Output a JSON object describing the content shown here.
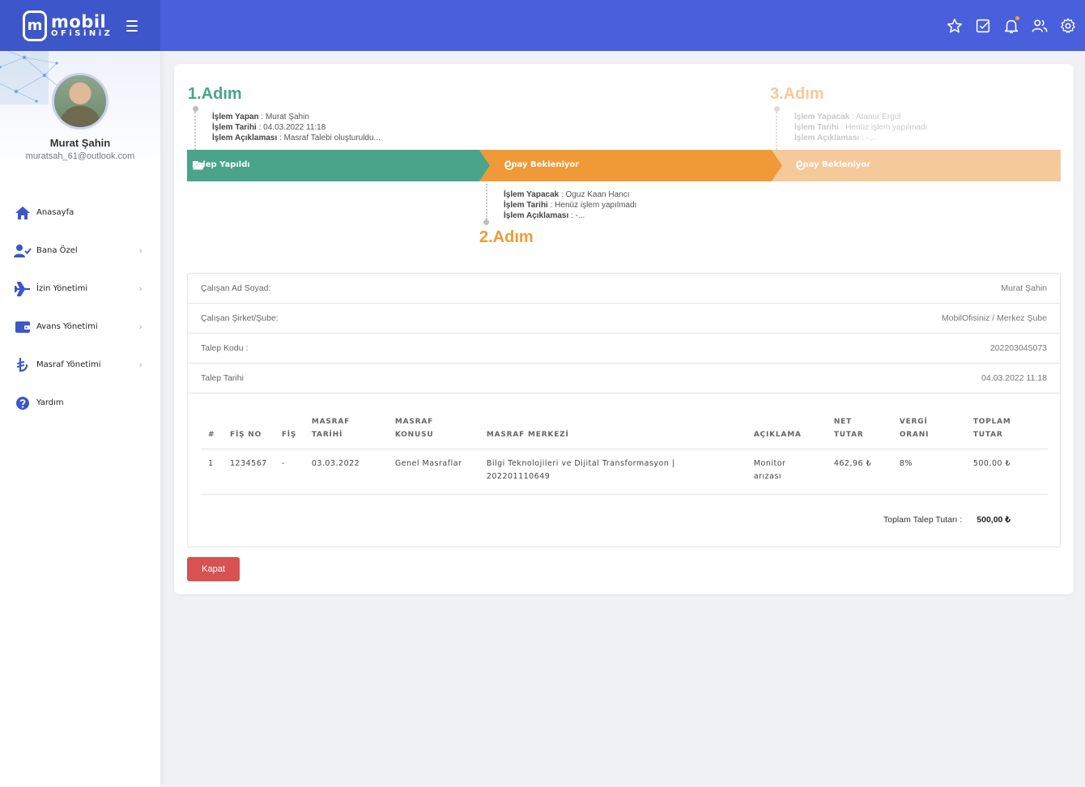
{
  "brand": {
    "line1": "mobil",
    "line2": "OFiSiNiZ",
    "mark": "m"
  },
  "user": {
    "name": "Murat Şahin",
    "email": "muratsah_61@outlook.com"
  },
  "nav": [
    {
      "label": "Anasayfa",
      "icon": "home-icon",
      "has_children": false
    },
    {
      "label": "Bana Özel",
      "icon": "user-check-icon",
      "has_children": true
    },
    {
      "label": "İzin Yönetimi",
      "icon": "plane-icon",
      "has_children": true
    },
    {
      "label": "Avans Yönetimi",
      "icon": "wallet-icon",
      "has_children": true
    },
    {
      "label": "Masraf Yönetimi",
      "icon": "lira-icon",
      "has_children": true
    },
    {
      "label": "Yardım",
      "icon": "help-icon",
      "has_children": false
    }
  ],
  "chevron": "›",
  "topbar_icons": [
    "star-icon",
    "checklist-icon",
    "bell-icon",
    "users-icon",
    "settings-icon"
  ],
  "steps": {
    "step1": {
      "title": "1.Adım",
      "l1_key": "İşlem Yapan",
      "l1_val": " : Murat Şahin",
      "l2_key": "İşlem Tarihi",
      "l2_val": " : 04.03.2022 11:18",
      "l3_key": "İşlem Açıklaması",
      "l3_val": " : Masraf Talebi oluşturuldu..."
    },
    "step2": {
      "title": "2.Adım",
      "l1_key": "İşlem Yapacak",
      "l1_val": " : Oguz Kaan Hancı",
      "l2_key": "İşlem Tarihi",
      "l2_val": " : Henüz işlem yapılmadı",
      "l3_key": "İşlem Açıklaması",
      "l3_val": " : -..."
    },
    "step3": {
      "title": "3.Adım",
      "l1_key": "İşlem Yapacak",
      "l1_val": " : Atanur Ergül",
      "l2_key": "İşlem Tarihi",
      "l2_val": " : Henüz işlem yapılmadı",
      "l3_key": "İşlem Açıklaması",
      "l3_val": " : -..."
    }
  },
  "progress": {
    "seg1": "Talep Yapıldı",
    "seg2": "Onay Bekleniyor",
    "seg3": "Onay Bekleniyor",
    "colors": {
      "done": "#4aa489",
      "active": "#ef9a36",
      "pending": "#f6c99a"
    }
  },
  "details": [
    {
      "label": "Çalışan Ad Soyad:",
      "value": "Murat Şahin"
    },
    {
      "label": "Çalışan Şirket/Şube:",
      "value": "MobilOfisiniz / Merkez Şube"
    },
    {
      "label": "Talep Kodu :",
      "value": "202203045073"
    },
    {
      "label": "Talep Tarihi",
      "value": "04.03.2022 11:18"
    }
  ],
  "table": {
    "headers": {
      "num": "#",
      "fis_no": "FİŞ NO",
      "fis": "FİŞ",
      "tarih_1": "MASRAF",
      "tarih_2": "TARİHİ",
      "konu_1": "MASRAF",
      "konu_2": "KONUSU",
      "merkez": "MASRAF MERKEZİ",
      "aciklama": "AÇIKLAMA",
      "net_1": "NET",
      "net_2": "TUTAR",
      "vergi_1": "VERGİ",
      "vergi_2": "ORANI",
      "toplam_1": "TOPLAM",
      "toplam_2": "TUTAR"
    },
    "rows": [
      {
        "num": "1",
        "fis_no": "1234567",
        "fis": "-",
        "tarih": "03.03.2022",
        "konu": "Genel Masraflar",
        "merkez_1": "Bilgi Teknolojileri ve Dijital Transformasyon |",
        "merkez_2": "202201110649",
        "aciklama_1": "Monitor",
        "aciklama_2": "arızası",
        "net": "462,96 ₺",
        "vergi": "8%",
        "toplam": "500,00 ₺"
      }
    ],
    "total_label": "Toplam Talep Tutarı :",
    "total_value": "500,00 ₺"
  },
  "close_button": "Kapat"
}
